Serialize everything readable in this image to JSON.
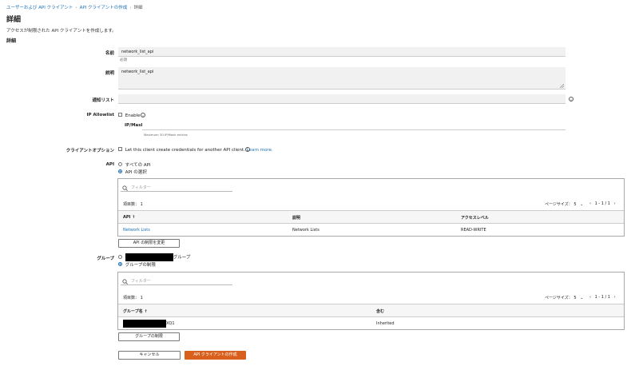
{
  "breadcrumb": {
    "items": [
      "ユーザーおよび API クライアント",
      "API クライアントの作成",
      "詳細"
    ],
    "sep": "›"
  },
  "page": {
    "title": "詳細",
    "subtitle": "アクセスが制限された API クライアントを作成します。",
    "section": "詳細"
  },
  "form": {
    "name_label": "名前",
    "name_value": "network_list_api",
    "name_hint": "必須",
    "desc_label": "説明",
    "desc_value": "network_list_api",
    "notify_label": "通知リスト",
    "notify_value": "",
    "ip_label": "IP Allowlist",
    "ip_enable": "Enable",
    "ipmask_label": "IP/Mask",
    "ipmask_hint": "Maximum 30 IP/Mask entries",
    "client_opt_label": "クライアントオプション",
    "client_opt_text": "Let this client create credentials for another API client.",
    "client_opt_link": "Learn more.",
    "api_label": "API",
    "api_all": "すべての API",
    "api_select": "API の選択",
    "group_label": "グループ",
    "group_all_suffix": "グループ",
    "group_restrict": "グループの制限"
  },
  "api_panel": {
    "filter_placeholder": "フィルター",
    "count": "項目数： 1",
    "page_size": "ページサイズ： 5",
    "pager": "1 - 1 / 1",
    "columns": [
      "API ↑",
      "説明",
      "アクセスレベル"
    ],
    "rows": [
      [
        "Network Lists",
        "Network Lists",
        "READ-WRITE"
      ]
    ],
    "change_button": "API の制限を変更"
  },
  "group_panel": {
    "filter_placeholder": "フィルター",
    "count": "項目数： 1",
    "page_size": "ページサイズ： 5",
    "pager": "1 - 1 / 1",
    "columns": [
      "グループ名 ↑",
      "含む"
    ],
    "rows": [
      [
        "XQ1",
        "Inherited"
      ]
    ],
    "change_button": "グループの制限"
  },
  "footer": {
    "cancel": "キャンセル",
    "create": "API クライアントの作成"
  },
  "colors": {
    "accent": "#d9601c",
    "link": "#1a6fb5"
  }
}
